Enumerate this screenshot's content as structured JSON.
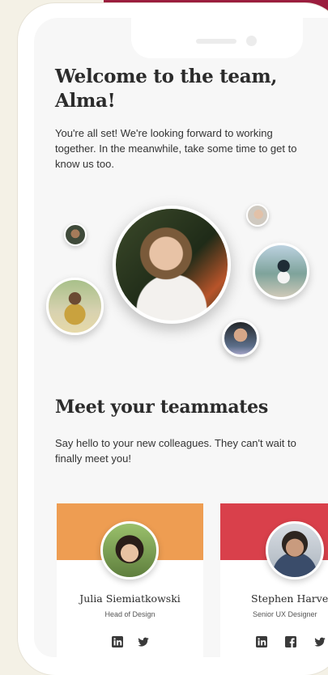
{
  "onboarding": {
    "title": "Welcome to the team, Alma!",
    "intro": "You're all set! We're looking forward to working together. In the meanwhile, take some time to get to know us too."
  },
  "teammates": {
    "heading": "Meet your teammates",
    "description": "Say hello to your new colleagues. They can't wait to finally meet you!",
    "members": [
      {
        "name": "Julia Siemiatkowski",
        "role": "Head of Design",
        "accent": "#ee9d52",
        "socials": [
          "linkedin-icon",
          "twitter-icon"
        ]
      },
      {
        "name": "Stephen Harvey",
        "role": "Senior UX Designer",
        "accent": "#d9404b",
        "socials": [
          "linkedin-icon",
          "facebook-icon",
          "twitter-icon"
        ]
      }
    ]
  },
  "colors": {
    "background": "#f4f1e6",
    "top_accent": "#9b1d3e",
    "screen": "#f7f7f7"
  }
}
